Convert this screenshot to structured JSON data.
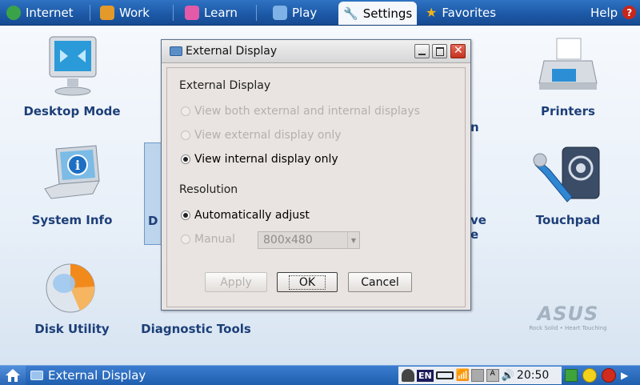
{
  "top_tabs": [
    {
      "label": "Internet",
      "icon": "globe-icon",
      "color": "#3aa34a"
    },
    {
      "label": "Work",
      "icon": "briefcase-icon",
      "color": "#e39a2a"
    },
    {
      "label": "Learn",
      "icon": "book-icon",
      "color": "#e35aa9"
    },
    {
      "label": "Play",
      "icon": "gamepad-icon",
      "color": "#7fb2e6"
    },
    {
      "label": "Settings",
      "icon": "wrench-icon",
      "color": "#6a6a6a",
      "active": true
    },
    {
      "label": "Favorites",
      "icon": "star-icon",
      "color": "#f0b41b"
    }
  ],
  "help": {
    "label": "Help",
    "icon": "help-icon"
  },
  "desktop": {
    "apps": [
      {
        "label": "Desktop Mode",
        "icon": "monitor-icon"
      },
      {
        "label": "Printers",
        "icon": "printer-icon"
      },
      {
        "label": "System Info",
        "icon": "laptop-info-icon"
      },
      {
        "label": "Touchpad",
        "icon": "touchpad-icon"
      },
      {
        "label": "Disk Utility",
        "icon": "pie-disk-icon"
      },
      {
        "label": "Diagnostic Tools",
        "icon": "stethoscope-icon"
      }
    ],
    "partial_labels": {
      "left": "D",
      "right_top": "n",
      "right_mid": "ve",
      "right_bot": "e"
    },
    "logo": {
      "brand": "ASUS",
      "tagline": "Rock Solid • Heart Touching"
    }
  },
  "dialog": {
    "title": "External Display",
    "section_display": "External Display",
    "display_options": [
      {
        "label": "View both external and internal displays",
        "selected": false,
        "enabled": false
      },
      {
        "label": "View external display only",
        "selected": false,
        "enabled": false
      },
      {
        "label": "View internal display only",
        "selected": true,
        "enabled": true
      }
    ],
    "section_resolution": "Resolution",
    "resolution_options": [
      {
        "label": "Automatically adjust",
        "selected": true,
        "enabled": true
      },
      {
        "label": "Manual",
        "selected": false,
        "enabled": false
      }
    ],
    "resolution_value": "800x480",
    "buttons": {
      "apply": "Apply",
      "ok": "OK",
      "cancel": "Cancel"
    }
  },
  "taskbar": {
    "task": "External Display",
    "lang": "EN",
    "time": "20:50"
  }
}
